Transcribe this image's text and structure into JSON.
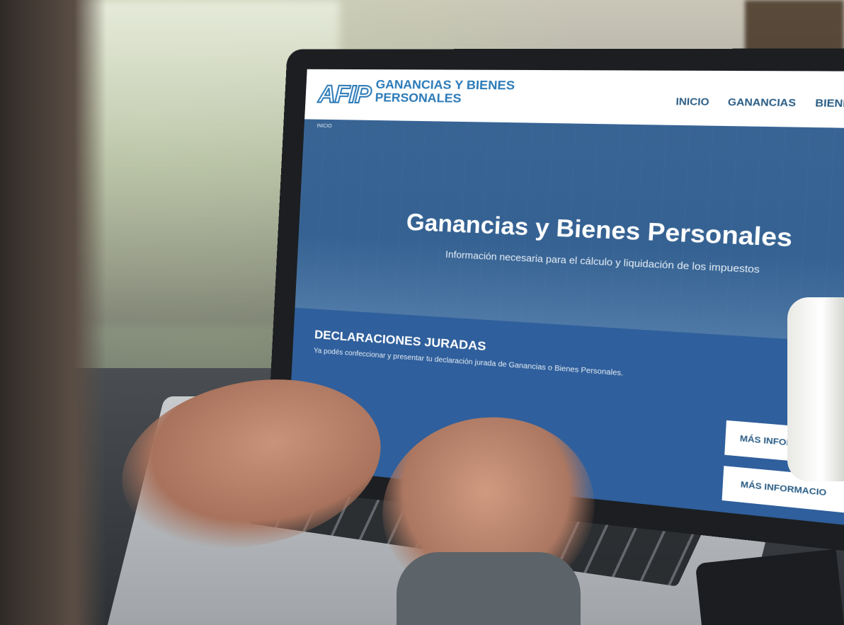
{
  "site": {
    "logo_text": "AFIP",
    "title": "GANANCIAS Y BIENES PERSONALES"
  },
  "nav": {
    "items": [
      "INICIO",
      "GANANCIAS",
      "BIENES PER"
    ]
  },
  "breadcrumb": "INICIO",
  "hero": {
    "title": "Ganancias y Bienes Personales",
    "subtitle": "Información necesaria para el cálculo y liquidación de los impuestos"
  },
  "section": {
    "title": "DECLARACIONES JURADAS",
    "text": "Ya podés confeccionar y presentar tu declaración jurada de Ganancias o Bienes Personales.",
    "button_1": "MÁS INFORMACIÓN",
    "button_2": "MÁS INFORMACIO"
  },
  "colors": {
    "brand_blue": "#2a7ab8",
    "section_blue": "#2f5f9c"
  }
}
